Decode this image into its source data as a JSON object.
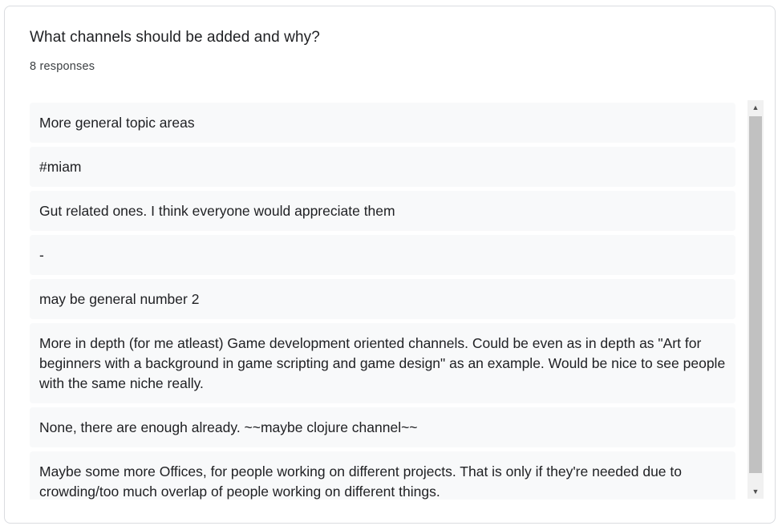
{
  "question": {
    "title": "What channels should be added and why?",
    "response_count": "8 responses"
  },
  "responses": [
    "More general topic areas",
    "#miam",
    "Gut related ones. I think everyone would appreciate them",
    "-",
    "may be general number 2",
    "More in depth (for me atleast) Game development oriented channels. Could be even as in depth as \"Art for beginners with a background in game scripting and game design\" as an example. Would be nice to see people with the same niche really.",
    "None, there are enough already. ~~maybe clojure channel~~",
    "Maybe some more Offices, for people working on different projects. That is only if they're needed due to crowding/too much overlap of people working on different things."
  ],
  "scrollbar": {
    "up_icon": "triangle-up",
    "down_icon": "triangle-down"
  },
  "colors": {
    "card_border": "#dadce0",
    "item_background": "#f8f9fa",
    "text": "#202124",
    "scroll_thumb": "#c1c1c1"
  }
}
